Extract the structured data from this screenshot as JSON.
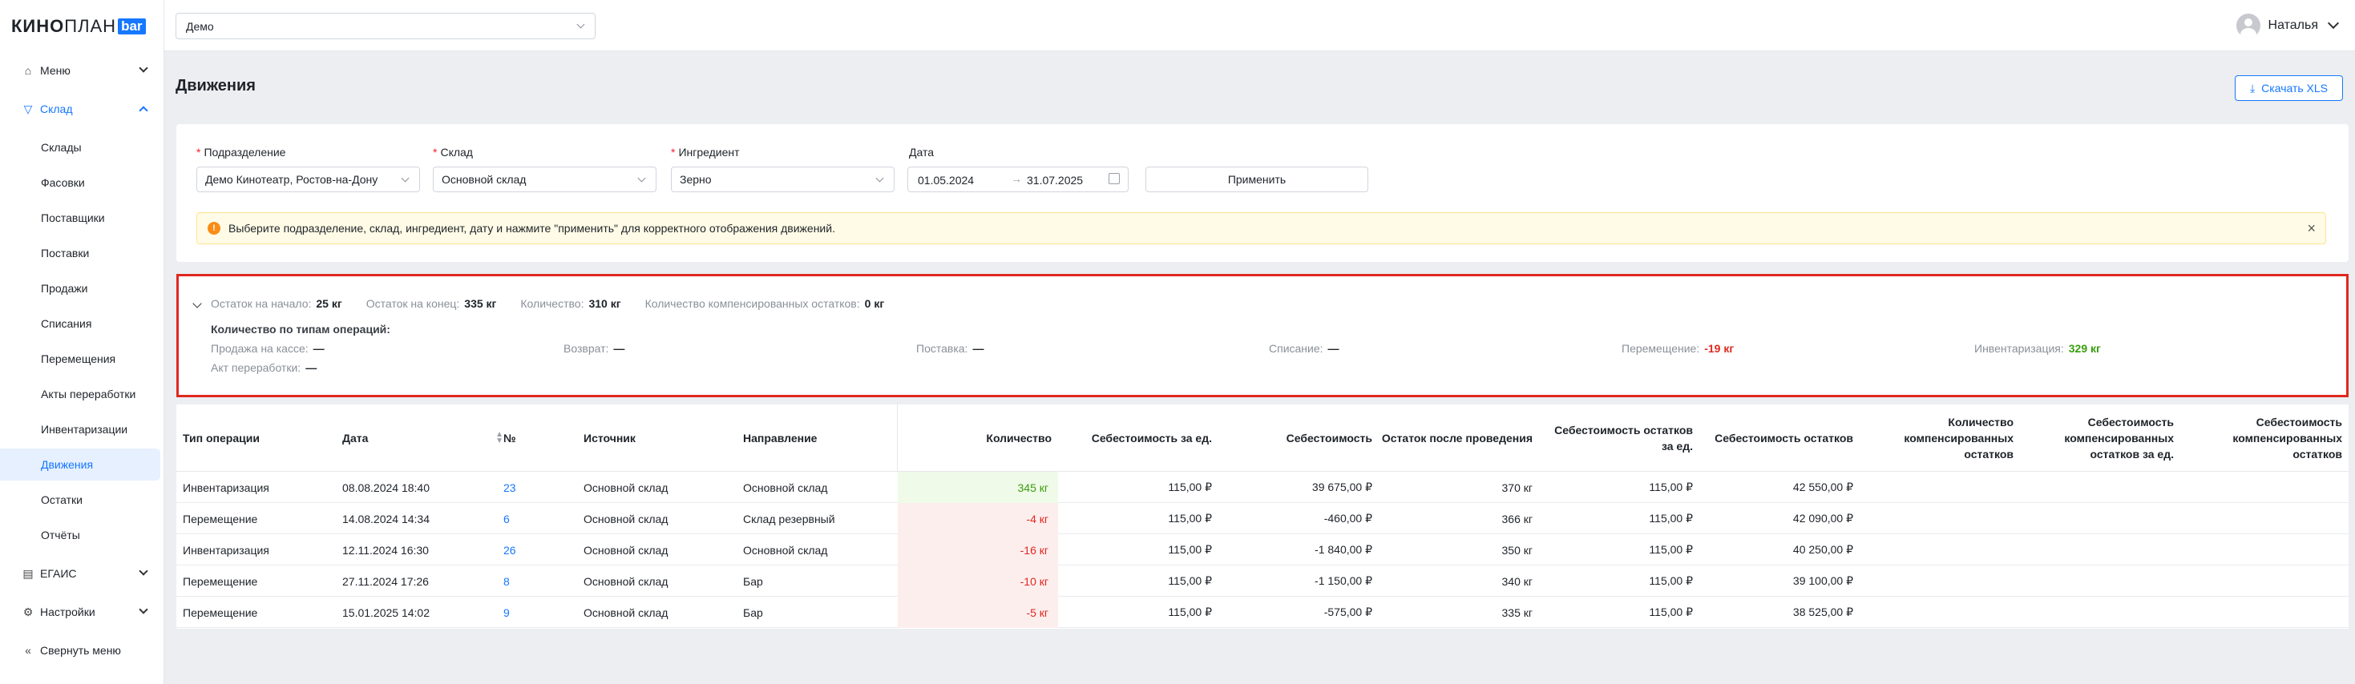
{
  "logo": {
    "kino": "КИНО",
    "plan": "ПЛАН",
    "bar": "bar"
  },
  "topbar": {
    "org": "Демо",
    "user": "Наталья"
  },
  "sidebar": {
    "menu": "Меню",
    "sklad": "Склад",
    "sub": [
      "Склады",
      "Фасовки",
      "Поставщики",
      "Поставки",
      "Продажи",
      "Списания",
      "Перемещения",
      "Акты переработки",
      "Инвентаризации",
      "Движения",
      "Остатки",
      "Отчёты"
    ],
    "egais": "ЕГАИС",
    "settings": "Настройки",
    "collapse": "Свернуть меню"
  },
  "page": {
    "title": "Движения",
    "download": "Скачать XLS"
  },
  "filters": {
    "division_label": "Подразделение",
    "division_value": "Демо Кинотеатр, Ростов-на-Дону",
    "warehouse_label": "Склад",
    "warehouse_value": "Основной склад",
    "ingredient_label": "Ингредиент",
    "ingredient_value": "Зерно",
    "date_label": "Дата",
    "date_from": "01.05.2024",
    "date_to": "31.07.2025",
    "apply": "Применить",
    "alert": "Выберите подразделение, склад, ингредиент, дату и нажмите \"применить\" для корректного отображения движений."
  },
  "summary": {
    "start_label": "Остаток на начало:",
    "start_value": "25 кг",
    "end_label": "Остаток на конец:",
    "end_value": "335 кг",
    "qty_label": "Количество:",
    "qty_value": "310 кг",
    "comp_label": "Количество компенсированных остатков:",
    "comp_value": "0 кг",
    "ops_title": "Количество по типам операций:",
    "ops": [
      {
        "label": "Продажа на кассе:",
        "value": "—"
      },
      {
        "label": "Возврат:",
        "value": "—"
      },
      {
        "label": "Поставка:",
        "value": "—"
      },
      {
        "label": "Списание:",
        "value": "—"
      },
      {
        "label": "Перемещение:",
        "value": "-19 кг"
      },
      {
        "label": "Инвентаризация:",
        "value": "329 кг"
      },
      {
        "label": "Акт переработки:",
        "value": "—"
      }
    ]
  },
  "table": {
    "headers": {
      "type": "Тип операции",
      "date": "Дата",
      "num": "№",
      "source": "Источник",
      "direction": "Направление",
      "qty": "Количество",
      "unit_cost": "Себестоимость за ед.",
      "cost": "Себестоимость",
      "rest_after": "Остаток после проведения",
      "rest_unit_cost_1": "Себестоимость остатков",
      "rest_unit_cost_2": "за ед.",
      "rest_cost": "Себестоимость остатков",
      "comp_qty_1": "Количество",
      "comp_qty_2": "компенсированных",
      "comp_qty_3": "остатков",
      "comp_unit_1": "Себестоимость",
      "comp_unit_2": "компенсированных",
      "comp_unit_3": "остатков за ед.",
      "comp_cost_1": "Себестоимость",
      "comp_cost_2": "компенсированных",
      "comp_cost_3": "остатков"
    },
    "rows": [
      {
        "type": "Инвентаризация",
        "date": "08.08.2024 18:40",
        "num": "23",
        "source": "Основной склад",
        "direction": "Основной склад",
        "qty": "345 кг",
        "unit_cost": "115,00 ₽",
        "cost": "39 675,00 ₽",
        "rest": "370 кг",
        "rest_unit": "115,00 ₽",
        "rest_cost": "42 550,00 ₽"
      },
      {
        "type": "Перемещение",
        "date": "14.08.2024 14:34",
        "num": "6",
        "source": "Основной склад",
        "direction": "Склад резервный",
        "qty": "-4 кг",
        "unit_cost": "115,00 ₽",
        "cost": "-460,00 ₽",
        "rest": "366 кг",
        "rest_unit": "115,00 ₽",
        "rest_cost": "42 090,00 ₽"
      },
      {
        "type": "Инвентаризация",
        "date": "12.11.2024 16:30",
        "num": "26",
        "source": "Основной склад",
        "direction": "Основной склад",
        "qty": "-16 кг",
        "unit_cost": "115,00 ₽",
        "cost": "-1 840,00 ₽",
        "rest": "350 кг",
        "rest_unit": "115,00 ₽",
        "rest_cost": "40 250,00 ₽"
      },
      {
        "type": "Перемещение",
        "date": "27.11.2024 17:26",
        "num": "8",
        "source": "Основной склад",
        "direction": "Бар",
        "qty": "-10 кг",
        "unit_cost": "115,00 ₽",
        "cost": "-1 150,00 ₽",
        "rest": "340 кг",
        "rest_unit": "115,00 ₽",
        "rest_cost": "39 100,00 ₽"
      },
      {
        "type": "Перемещение",
        "date": "15.01.2025 14:02",
        "num": "9",
        "source": "Основной склад",
        "direction": "Бар",
        "qty": "-5 кг",
        "unit_cost": "115,00 ₽",
        "cost": "-575,00 ₽",
        "rest": "335 кг",
        "rest_unit": "115,00 ₽",
        "rest_cost": "38 525,00 ₽"
      }
    ]
  }
}
